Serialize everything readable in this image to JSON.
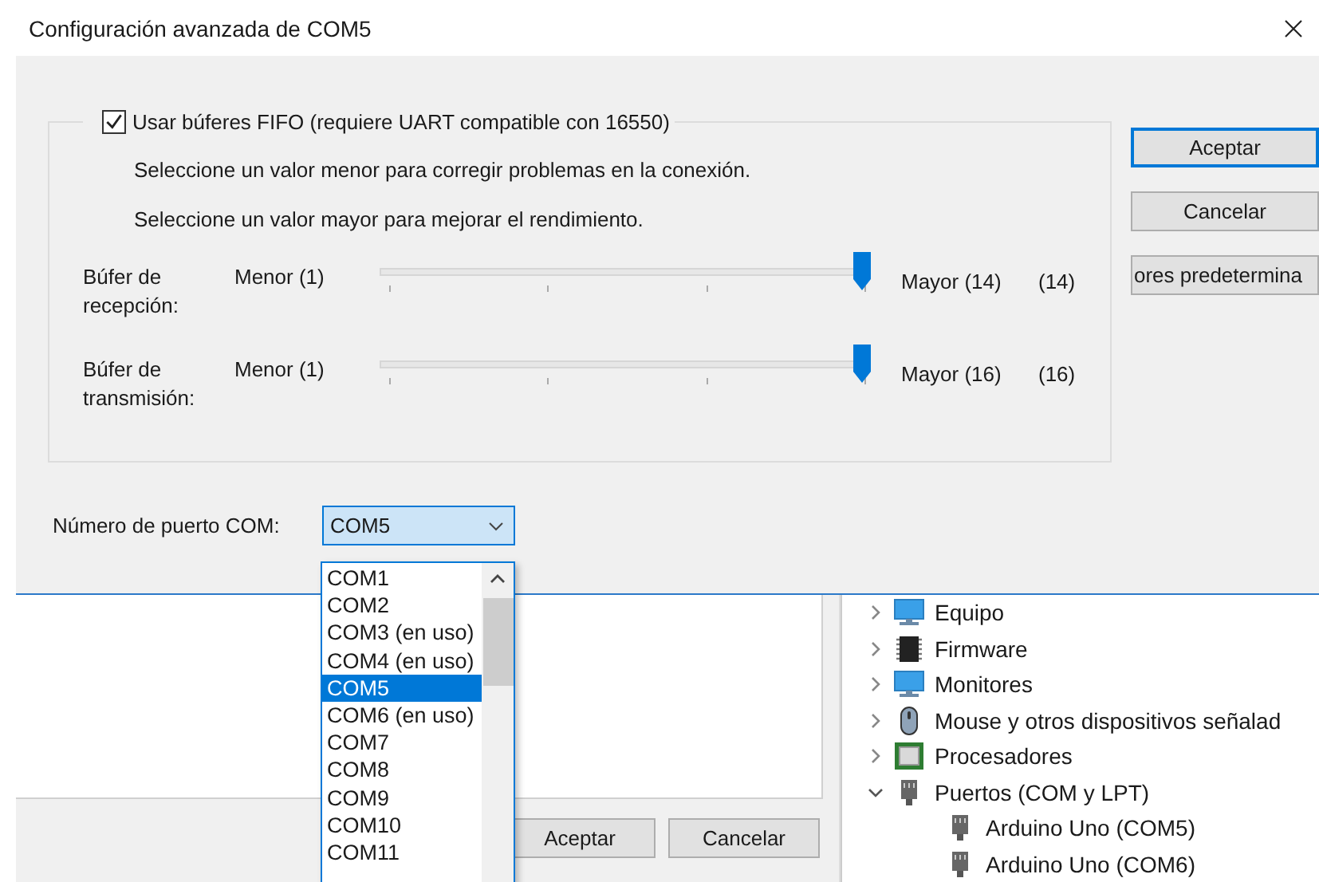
{
  "dialog": {
    "title": "Configuración avanzada de COM5"
  },
  "fifo": {
    "label": "Usar búferes FIFO (requiere UART compatible con 16550)",
    "checked": true
  },
  "hints": [
    "Seleccione un valor menor para corregir problemas en la conexión.",
    "Seleccione un valor mayor para mejorar el rendimiento."
  ],
  "buffers": [
    {
      "label": "Búfer de recepción:",
      "min": "Menor (1)",
      "max": "Mayor (14)",
      "value": "(14)",
      "level": 1
    },
    {
      "label": "Búfer de transmisión:",
      "min": "Menor (1)",
      "max": "Mayor (16)",
      "value": "(16)",
      "level": 1
    }
  ],
  "buttons": [
    {
      "label": "Aceptar",
      "default": true
    },
    {
      "label": "Cancelar",
      "default": false
    },
    {
      "label": "ores predetermina",
      "default": false
    }
  ],
  "port": {
    "label": "Número de puerto COM:",
    "value": "COM5",
    "options": [
      {
        "label": "COM1",
        "selected": false
      },
      {
        "label": "COM2",
        "selected": false
      },
      {
        "label": "COM3 (en uso)",
        "selected": false
      },
      {
        "label": "COM4 (en uso)",
        "selected": false
      },
      {
        "label": "COM5",
        "selected": true
      },
      {
        "label": "COM6 (en uso)",
        "selected": false
      },
      {
        "label": "COM7",
        "selected": false
      },
      {
        "label": "COM8",
        "selected": false
      },
      {
        "label": "COM9",
        "selected": false
      },
      {
        "label": "COM10",
        "selected": false
      },
      {
        "label": "COM11",
        "selected": false
      }
    ]
  },
  "background_dialog": {
    "buttons": [
      "Aceptar",
      "Cancelar"
    ]
  },
  "device_tree": [
    {
      "label": "Equipo",
      "kind": "computer",
      "expanded": false
    },
    {
      "label": "Firmware",
      "kind": "chip",
      "expanded": false
    },
    {
      "label": "Monitores",
      "kind": "monitor",
      "expanded": false
    },
    {
      "label": "Mouse y otros dispositivos señalad",
      "kind": "mouse",
      "expanded": false
    },
    {
      "label": "Procesadores",
      "kind": "processor",
      "expanded": false
    },
    {
      "label": "Puertos (COM y LPT)",
      "kind": "port",
      "expanded": true,
      "children": [
        {
          "label": "Arduino Uno (COM5)",
          "kind": "port"
        },
        {
          "label": "Arduino Uno (COM6)",
          "kind": "port"
        }
      ]
    }
  ]
}
